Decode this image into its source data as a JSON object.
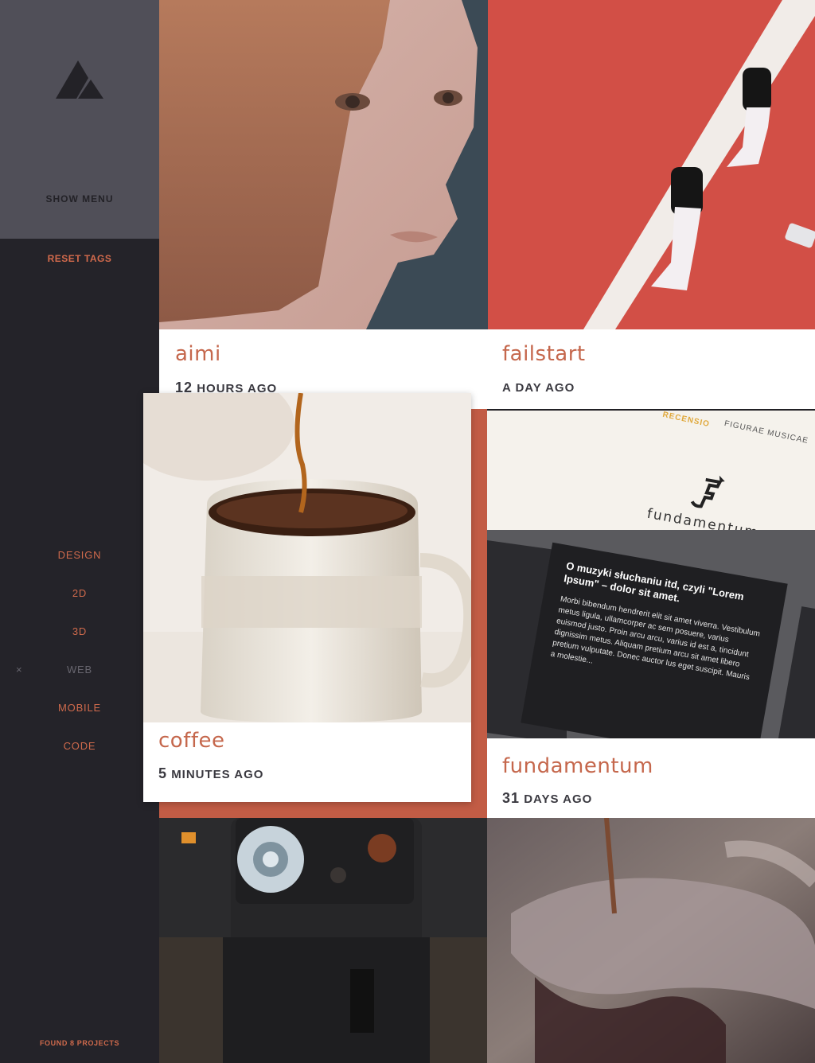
{
  "sidebar": {
    "show_menu": "SHOW MENU",
    "reset_tags": "RESET TAGS",
    "tags": [
      {
        "label": "DESIGN",
        "active": false
      },
      {
        "label": "2D",
        "active": false
      },
      {
        "label": "3D",
        "active": false
      },
      {
        "label": "WEB",
        "active": true,
        "remove": "×"
      },
      {
        "label": "MOBILE",
        "active": false
      },
      {
        "label": "CODE",
        "active": false
      }
    ],
    "found": "FOUND 8 PROJECTS"
  },
  "projects": [
    {
      "title": "aimi",
      "time_num": "12",
      "time_text": "HOURS AGO"
    },
    {
      "title": "failstart",
      "time_num": "",
      "time_text": "A DAY AGO"
    },
    {
      "title": "coffee",
      "time_num": "5",
      "time_text": "MINUTES AGO"
    },
    {
      "title": "fundamentum",
      "time_num": "31",
      "time_text": "DAYS AGO"
    }
  ],
  "fundamentum_preview": {
    "nav1": "RECENSIO",
    "nav2": "FIGURAE MUSICAE",
    "brand": "fundamentum",
    "heading": "O muzyki słuchaniu itd, czyli \"Lorem Ipsum\" – dolor sit amet.",
    "body": "Morbi bibendum hendrerit elit sit amet viverra. Vestibulum metus ligula, ullamcorper ac sem posuere, varius euismod justo. Proin arcu arcu, varius id est a, tincidunt dignissim metus. Aliquam pretium arcu sit amet libero pretium vulputate. Donec auctor lus eget suscipit. Mauris a molestie..."
  },
  "colors": {
    "accent": "#c5674c",
    "sidebar_bg": "#242329",
    "brand_bg": "#504f58"
  }
}
